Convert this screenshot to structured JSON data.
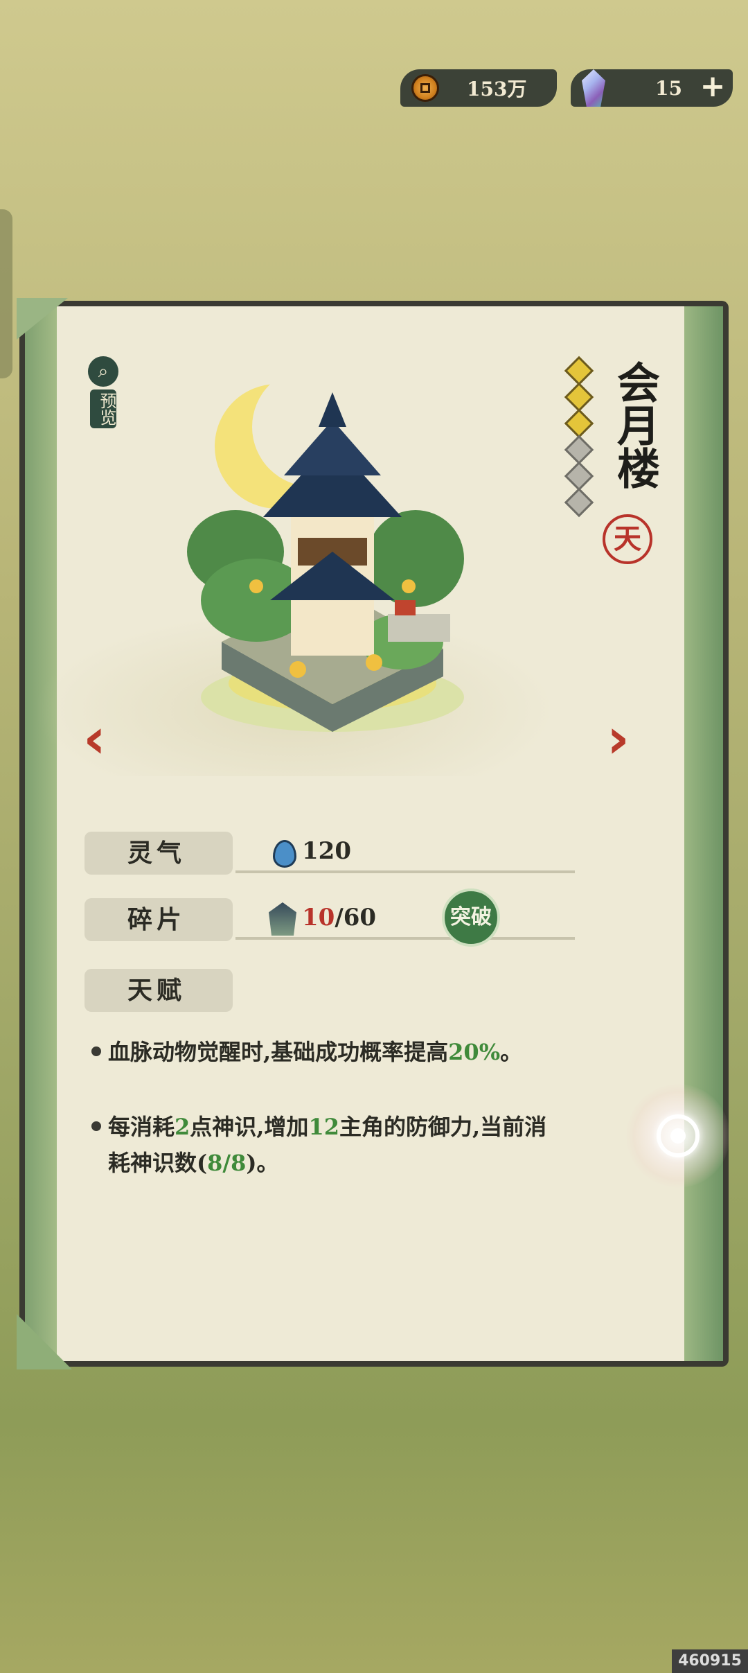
{
  "currency": {
    "coins": "153万",
    "gems": "15",
    "coin_icon": "copper-coin-icon",
    "gem_icon": "spirit-crystal-icon",
    "add_label": "+"
  },
  "preview": {
    "icon": "magnify-icon",
    "label": "预览"
  },
  "building": {
    "name": "会月楼",
    "seal": "天",
    "stars_total": 6,
    "stars_filled": 3
  },
  "nav": {
    "prev": "‹",
    "next": "›"
  },
  "stats": {
    "lingqi": {
      "label": "灵气",
      "value": "120",
      "icon": "water-drop-icon"
    },
    "fragments": {
      "label": "碎片",
      "current": "10",
      "separator": "/",
      "required": "60",
      "icon": "fragment-icon"
    },
    "breakthrough_label": "突破",
    "talent_label": "天赋"
  },
  "talents": [
    {
      "part1": "血脉动物觉醒时,基础成功概率提高",
      "highlight": "20%",
      "part2": "。"
    },
    {
      "text_a": "每消耗",
      "num_a": "2",
      "text_b": "点神识,增加",
      "num_b": "12",
      "text_c": "主角的防御力,当前消耗神识数(",
      "num_c": "8/8",
      "text_d": ")。"
    }
  ],
  "watermark": "460915",
  "colors": {
    "accent_red": "#b8332a",
    "accent_green": "#3f8a3a",
    "star_gold": "#e4c53a"
  }
}
